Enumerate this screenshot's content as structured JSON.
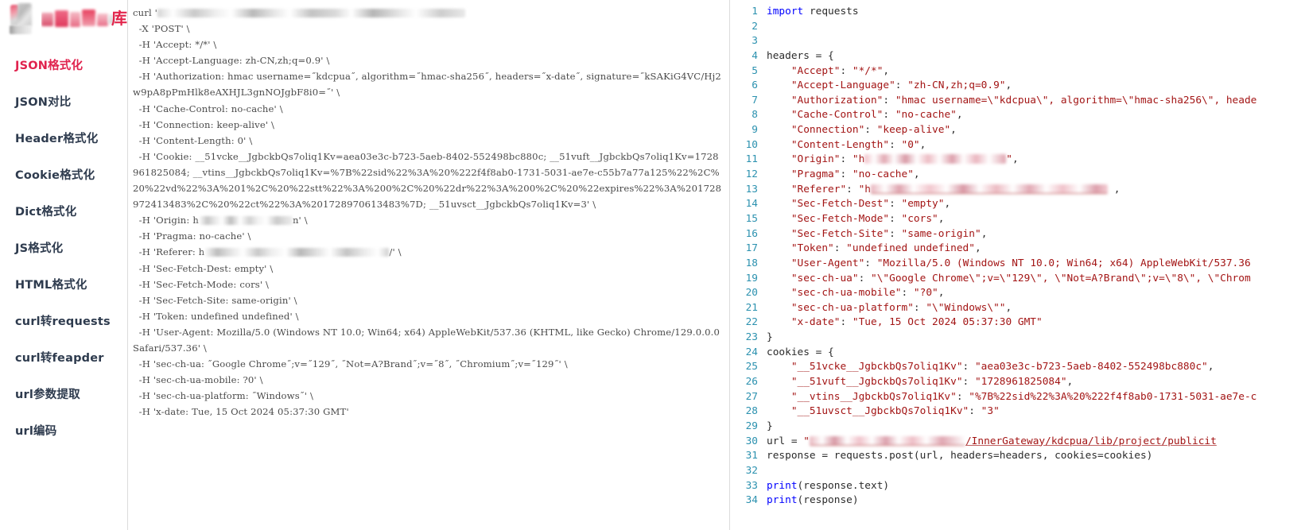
{
  "sidebar": {
    "logo_char": "库",
    "items": [
      {
        "label": "JSON格式化",
        "active": true
      },
      {
        "label": "JSON对比",
        "active": false
      },
      {
        "label": "Header格式化",
        "active": false
      },
      {
        "label": "Cookie格式化",
        "active": false
      },
      {
        "label": "Dict格式化",
        "active": false
      },
      {
        "label": "JS格式化",
        "active": false
      },
      {
        "label": "HTML格式化",
        "active": false
      },
      {
        "label": "curl转requests",
        "active": false
      },
      {
        "label": "curl转feapder",
        "active": false
      },
      {
        "label": "url参数提取",
        "active": false
      },
      {
        "label": "url编码",
        "active": false
      }
    ]
  },
  "curl_panel": {
    "lines": [
      {
        "prefix": "curl '",
        "redacted": "url1",
        "suffix": ""
      },
      {
        "text": "  -X 'POST' \\"
      },
      {
        "text": "  -H 'Accept: */*' \\"
      },
      {
        "text": "  -H 'Accept-Language: zh-CN,zh;q=0.9' \\"
      },
      {
        "text": "  -H 'Authorization: hmac username=˝kdcpua˝, algorithm=˝hmac-sha256˝, headers=˝x-date˝, signature=˝kSAKiG4VC/Hj2w9pA8pPmHlk8eAXHJL3gnNOJgbF8i0=˝' \\"
      },
      {
        "text": "  -H 'Cache-Control: no-cache' \\"
      },
      {
        "text": "  -H 'Connection: keep-alive' \\"
      },
      {
        "text": "  -H 'Content-Length: 0' \\"
      },
      {
        "text": "  -H 'Cookie: __51vcke__JgbckbQs7oliq1Kv=aea03e3c-b723-5aeb-8402-552498bc880c; __51vuft__JgbckbQs7oliq1Kv=1728961825084; __vtins__JgbckbQs7oliq1Kv=%7B%22sid%22%3A%20%222f4f8ab0-1731-5031-ae7e-c55b7a77a125%22%2C%20%22vd%22%3A%201%2C%20%22stt%22%3A%200%2C%20%22dr%22%3A%200%2C%20%22expires%22%3A%201728972413483%2C%20%22ct%22%3A%201728970613483%7D; __51uvsct__JgbckbQs7oliq1Kv=3' \\"
      },
      {
        "prefix": "  -H 'Origin: h",
        "redacted": "origin",
        "suffix": "n' \\"
      },
      {
        "text": "  -H 'Pragma: no-cache' \\"
      },
      {
        "prefix": "  -H 'Referer: h",
        "redacted": "referer",
        "suffix": "/' \\"
      },
      {
        "text": "  -H 'Sec-Fetch-Dest: empty' \\"
      },
      {
        "text": "  -H 'Sec-Fetch-Mode: cors' \\"
      },
      {
        "text": "  -H 'Sec-Fetch-Site: same-origin' \\"
      },
      {
        "text": "  -H 'Token: undefined undefined' \\"
      },
      {
        "text": "  -H 'User-Agent: Mozilla/5.0 (Windows NT 10.0; Win64; x64) AppleWebKit/537.36 (KHTML, like Gecko) Chrome/129.0.0.0 Safari/537.36' \\"
      },
      {
        "text": "  -H 'sec-ch-ua: ˝Google Chrome˝;v=˝129˝, ˝Not=A?Brand˝;v=˝8˝, ˝Chromium˝;v=˝129˝' \\"
      },
      {
        "text": "  -H 'sec-ch-ua-mobile: ?0' \\"
      },
      {
        "text": "  -H 'sec-ch-ua-platform: ˝Windows˝' \\"
      },
      {
        "text": "  -H 'x-date: Tue, 15 Oct 2024 05:37:30 GMT'"
      }
    ]
  },
  "code_panel": {
    "lines": [
      {
        "n": "1",
        "tokens": [
          {
            "t": "kw",
            "v": "import"
          },
          {
            "t": "pln",
            "v": " requests"
          }
        ]
      },
      {
        "n": "2",
        "tokens": []
      },
      {
        "n": "3",
        "tokens": []
      },
      {
        "n": "4",
        "tokens": [
          {
            "t": "pln",
            "v": "headers = {"
          }
        ]
      },
      {
        "n": "5",
        "tokens": [
          {
            "t": "key",
            "v": "    \"Accept\""
          },
          {
            "t": "pln",
            "v": ": "
          },
          {
            "t": "str",
            "v": "\"*/*\""
          },
          {
            "t": "pln",
            "v": ","
          }
        ]
      },
      {
        "n": "6",
        "tokens": [
          {
            "t": "key",
            "v": "    \"Accept-Language\""
          },
          {
            "t": "pln",
            "v": ": "
          },
          {
            "t": "str",
            "v": "\"zh-CN,zh;q=0.9\""
          },
          {
            "t": "pln",
            "v": ","
          }
        ]
      },
      {
        "n": "7",
        "tokens": [
          {
            "t": "key",
            "v": "    \"Authorization\""
          },
          {
            "t": "pln",
            "v": ": "
          },
          {
            "t": "str",
            "v": "\"hmac username=\\\"kdcpua\\\", algorithm=\\\"hmac-sha256\\\", heade"
          }
        ]
      },
      {
        "n": "8",
        "tokens": [
          {
            "t": "key",
            "v": "    \"Cache-Control\""
          },
          {
            "t": "pln",
            "v": ": "
          },
          {
            "t": "str",
            "v": "\"no-cache\""
          },
          {
            "t": "pln",
            "v": ","
          }
        ]
      },
      {
        "n": "9",
        "tokens": [
          {
            "t": "key",
            "v": "    \"Connection\""
          },
          {
            "t": "pln",
            "v": ": "
          },
          {
            "t": "str",
            "v": "\"keep-alive\""
          },
          {
            "t": "pln",
            "v": ","
          }
        ]
      },
      {
        "n": "10",
        "tokens": [
          {
            "t": "key",
            "v": "    \"Content-Length\""
          },
          {
            "t": "pln",
            "v": ": "
          },
          {
            "t": "str",
            "v": "\"0\""
          },
          {
            "t": "pln",
            "v": ","
          }
        ]
      },
      {
        "n": "11",
        "tokens": [
          {
            "t": "key",
            "v": "    \"Origin\""
          },
          {
            "t": "pln",
            "v": ": "
          },
          {
            "t": "str",
            "v": "\"h"
          },
          {
            "t": "redact",
            "v": "rdc-origin"
          },
          {
            "t": "str",
            "v": "\""
          },
          {
            "t": "pln",
            "v": ","
          }
        ]
      },
      {
        "n": "12",
        "tokens": [
          {
            "t": "key",
            "v": "    \"Pragma\""
          },
          {
            "t": "pln",
            "v": ": "
          },
          {
            "t": "str",
            "v": "\"no-cache\""
          },
          {
            "t": "pln",
            "v": ","
          }
        ]
      },
      {
        "n": "13",
        "tokens": [
          {
            "t": "key",
            "v": "    \"Referer\""
          },
          {
            "t": "pln",
            "v": ": "
          },
          {
            "t": "str",
            "v": "\"h"
          },
          {
            "t": "redact",
            "v": "rdc-referer"
          },
          {
            "t": "pln",
            "v": " ,"
          }
        ]
      },
      {
        "n": "14",
        "tokens": [
          {
            "t": "key",
            "v": "    \"Sec-Fetch-Dest\""
          },
          {
            "t": "pln",
            "v": ": "
          },
          {
            "t": "str",
            "v": "\"empty\""
          },
          {
            "t": "pln",
            "v": ","
          }
        ]
      },
      {
        "n": "15",
        "tokens": [
          {
            "t": "key",
            "v": "    \"Sec-Fetch-Mode\""
          },
          {
            "t": "pln",
            "v": ": "
          },
          {
            "t": "str",
            "v": "\"cors\""
          },
          {
            "t": "pln",
            "v": ","
          }
        ]
      },
      {
        "n": "16",
        "tokens": [
          {
            "t": "key",
            "v": "    \"Sec-Fetch-Site\""
          },
          {
            "t": "pln",
            "v": ": "
          },
          {
            "t": "str",
            "v": "\"same-origin\""
          },
          {
            "t": "pln",
            "v": ","
          }
        ]
      },
      {
        "n": "17",
        "tokens": [
          {
            "t": "key",
            "v": "    \"Token\""
          },
          {
            "t": "pln",
            "v": ": "
          },
          {
            "t": "str",
            "v": "\"undefined undefined\""
          },
          {
            "t": "pln",
            "v": ","
          }
        ]
      },
      {
        "n": "18",
        "tokens": [
          {
            "t": "key",
            "v": "    \"User-Agent\""
          },
          {
            "t": "pln",
            "v": ": "
          },
          {
            "t": "str",
            "v": "\"Mozilla/5.0 (Windows NT 10.0; Win64; x64) AppleWebKit/537.36"
          }
        ]
      },
      {
        "n": "19",
        "tokens": [
          {
            "t": "key",
            "v": "    \"sec-ch-ua\""
          },
          {
            "t": "pln",
            "v": ": "
          },
          {
            "t": "str",
            "v": "\"\\\"Google Chrome\\\";v=\\\"129\\\", \\\"Not=A?Brand\\\";v=\\\"8\\\", \\\"Chrom"
          }
        ]
      },
      {
        "n": "20",
        "tokens": [
          {
            "t": "key",
            "v": "    \"sec-ch-ua-mobile\""
          },
          {
            "t": "pln",
            "v": ": "
          },
          {
            "t": "str",
            "v": "\"?0\""
          },
          {
            "t": "pln",
            "v": ","
          }
        ]
      },
      {
        "n": "21",
        "tokens": [
          {
            "t": "key",
            "v": "    \"sec-ch-ua-platform\""
          },
          {
            "t": "pln",
            "v": ": "
          },
          {
            "t": "str",
            "v": "\"\\\"Windows\\\"\""
          },
          {
            "t": "pln",
            "v": ","
          }
        ]
      },
      {
        "n": "22",
        "tokens": [
          {
            "t": "key",
            "v": "    \"x-date\""
          },
          {
            "t": "pln",
            "v": ": "
          },
          {
            "t": "str",
            "v": "\"Tue, 15 Oct 2024 05:37:30 GMT\""
          }
        ]
      },
      {
        "n": "23",
        "tokens": [
          {
            "t": "pln",
            "v": "}"
          }
        ]
      },
      {
        "n": "24",
        "tokens": [
          {
            "t": "pln",
            "v": "cookies = {"
          }
        ]
      },
      {
        "n": "25",
        "tokens": [
          {
            "t": "key",
            "v": "    \"__51vcke__JgbckbQs7oliq1Kv\""
          },
          {
            "t": "pln",
            "v": ": "
          },
          {
            "t": "str",
            "v": "\"aea03e3c-b723-5aeb-8402-552498bc880c\""
          },
          {
            "t": "pln",
            "v": ","
          }
        ]
      },
      {
        "n": "26",
        "tokens": [
          {
            "t": "key",
            "v": "    \"__51vuft__JgbckbQs7oliq1Kv\""
          },
          {
            "t": "pln",
            "v": ": "
          },
          {
            "t": "str",
            "v": "\"1728961825084\""
          },
          {
            "t": "pln",
            "v": ","
          }
        ]
      },
      {
        "n": "27",
        "tokens": [
          {
            "t": "key",
            "v": "    \"__vtins__JgbckbQs7oliq1Kv\""
          },
          {
            "t": "pln",
            "v": ": "
          },
          {
            "t": "str",
            "v": "\"%7B%22sid%22%3A%20%222f4f8ab0-1731-5031-ae7e-c"
          }
        ]
      },
      {
        "n": "28",
        "tokens": [
          {
            "t": "key",
            "v": "    \"__51uvsct__JgbckbQs7oliq1Kv\""
          },
          {
            "t": "pln",
            "v": ": "
          },
          {
            "t": "str",
            "v": "\"3\""
          }
        ]
      },
      {
        "n": "29",
        "tokens": [
          {
            "t": "pln",
            "v": "}"
          }
        ]
      },
      {
        "n": "30",
        "tokens": [
          {
            "t": "pln",
            "v": "url = "
          },
          {
            "t": "str",
            "v": "\""
          },
          {
            "t": "redact",
            "v": "rdc-url"
          },
          {
            "t": "lnk",
            "v": "/InnerGateway/kdcpua/lib/project/publicit"
          }
        ]
      },
      {
        "n": "31",
        "tokens": [
          {
            "t": "pln",
            "v": "response = requests.post(url, headers=headers, cookies=cookies)"
          }
        ]
      },
      {
        "n": "32",
        "tokens": []
      },
      {
        "n": "33",
        "tokens": [
          {
            "t": "fn",
            "v": "print"
          },
          {
            "t": "pln",
            "v": "(response.text)"
          }
        ]
      },
      {
        "n": "34",
        "tokens": [
          {
            "t": "fn",
            "v": "print"
          },
          {
            "t": "pln",
            "v": "(response)"
          }
        ]
      }
    ]
  }
}
